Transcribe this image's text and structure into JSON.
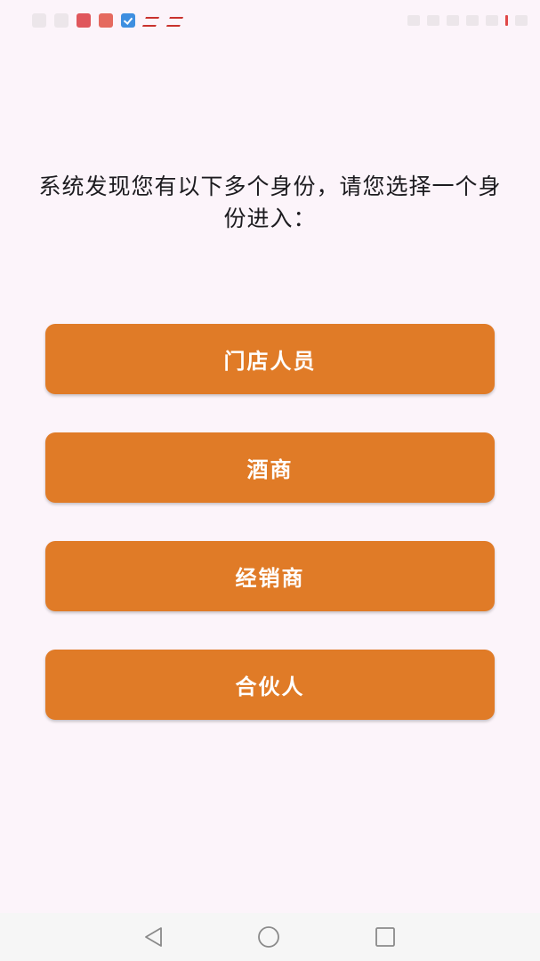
{
  "status_bar": {
    "left_icons": [
      "notification-icon",
      "notification-icon",
      "huawei-app-icon",
      "clipboard-app-icon",
      "shield-check-app-icon",
      "sina-weibo-icon",
      "sina-weibo-icon"
    ],
    "right_icons": [
      "status-icon",
      "status-icon",
      "status-icon",
      "signal-icon",
      "wifi-icon",
      "battery-icon"
    ]
  },
  "prompt": {
    "text": "系统发现您有以下多个身份，请您选择一个身份进入："
  },
  "roles": [
    {
      "label": "门店人员"
    },
    {
      "label": "酒商"
    },
    {
      "label": "经销商"
    },
    {
      "label": "合伙人"
    }
  ],
  "nav_bar": {
    "icons": [
      "back-icon",
      "home-icon",
      "recent-apps-icon"
    ]
  },
  "colors": {
    "background": "#fcf4fa",
    "button": "#e07b27",
    "button_text": "#ffffff",
    "prompt_text": "#1c1b1f"
  }
}
